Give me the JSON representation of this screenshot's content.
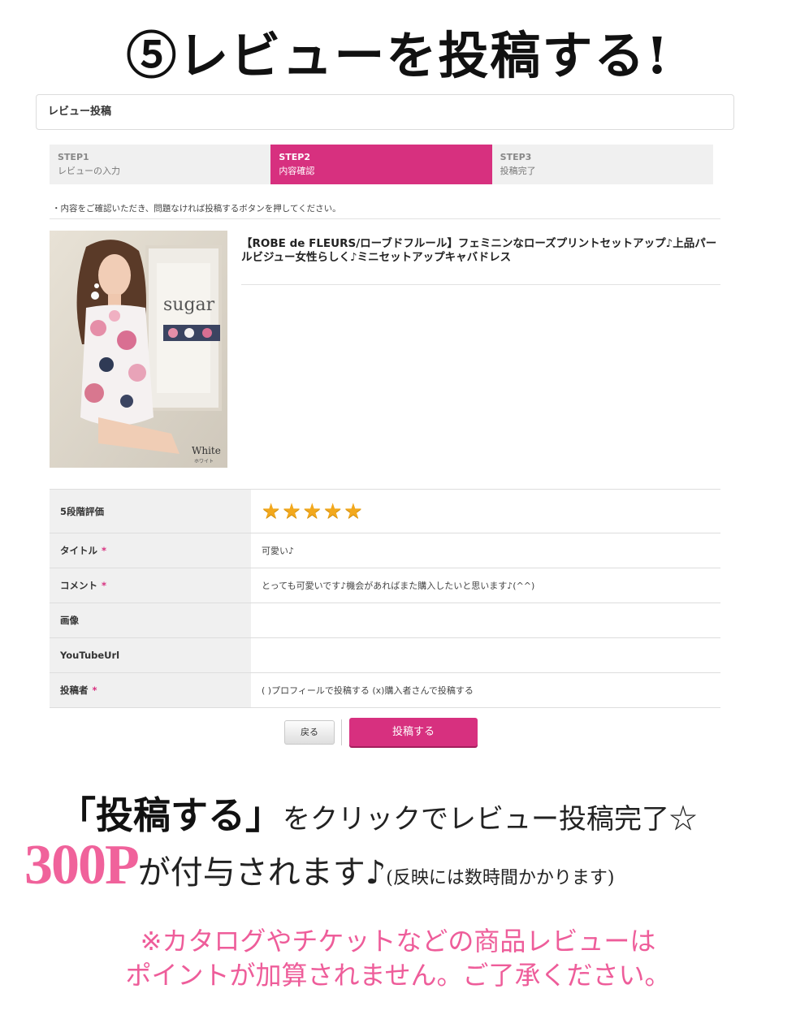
{
  "headline": "⑤レビューを投稿する!",
  "panel": {
    "title": "レビュー投稿"
  },
  "steps": [
    {
      "no": "STEP1",
      "label": "レビューの入力",
      "active": false
    },
    {
      "no": "STEP2",
      "label": "内容確認",
      "active": true
    },
    {
      "no": "STEP3",
      "label": "投稿完了",
      "active": false
    }
  ],
  "notice": "・内容をご確認いただき、問題なければ投稿するボタンを押してください。",
  "product": {
    "title": "【ROBE de FLEURS/ローブドフルール】フェミニンなローズプリントセットアップ♪上品パールビジュー女性らしく♪ミニセットアップキャバドレス",
    "image_brand": "sugar",
    "image_color": "White",
    "image_color_kana": "ホワイト"
  },
  "review": {
    "rating_label": "5段階評価",
    "rating": 5,
    "rating_max": 5,
    "title_label": "タイトル",
    "title_value": "可愛い♪",
    "comment_label": "コメント",
    "comment_value": "とっても可愛いです♪機会があればまた購入したいと思います♪(^^)",
    "image_label": "画像",
    "youtube_label": "YouTubeUrl",
    "poster_label": "投稿者",
    "poster_value": "(  )プロフィールで投稿する  (x)購入者さんで投稿する",
    "required_mark": "*"
  },
  "buttons": {
    "back": "戻る",
    "submit": "投稿する"
  },
  "bottom": {
    "line1_big": "「投稿する」",
    "line1_rest": "をクリックでレビュー投稿完了☆",
    "points": "300P",
    "grant": "が付与されます♪",
    "grant_note": "(反映には数時間かかります)",
    "note_line1": "※カタログやチケットなどの商品レビューは",
    "note_line2": "ポイントが加算されません。ご了承ください。"
  },
  "colors": {
    "accent": "#d7307f",
    "points_pink": "#f0629b",
    "note_pink": "#ee5d9a",
    "star": "#f2a81d"
  }
}
